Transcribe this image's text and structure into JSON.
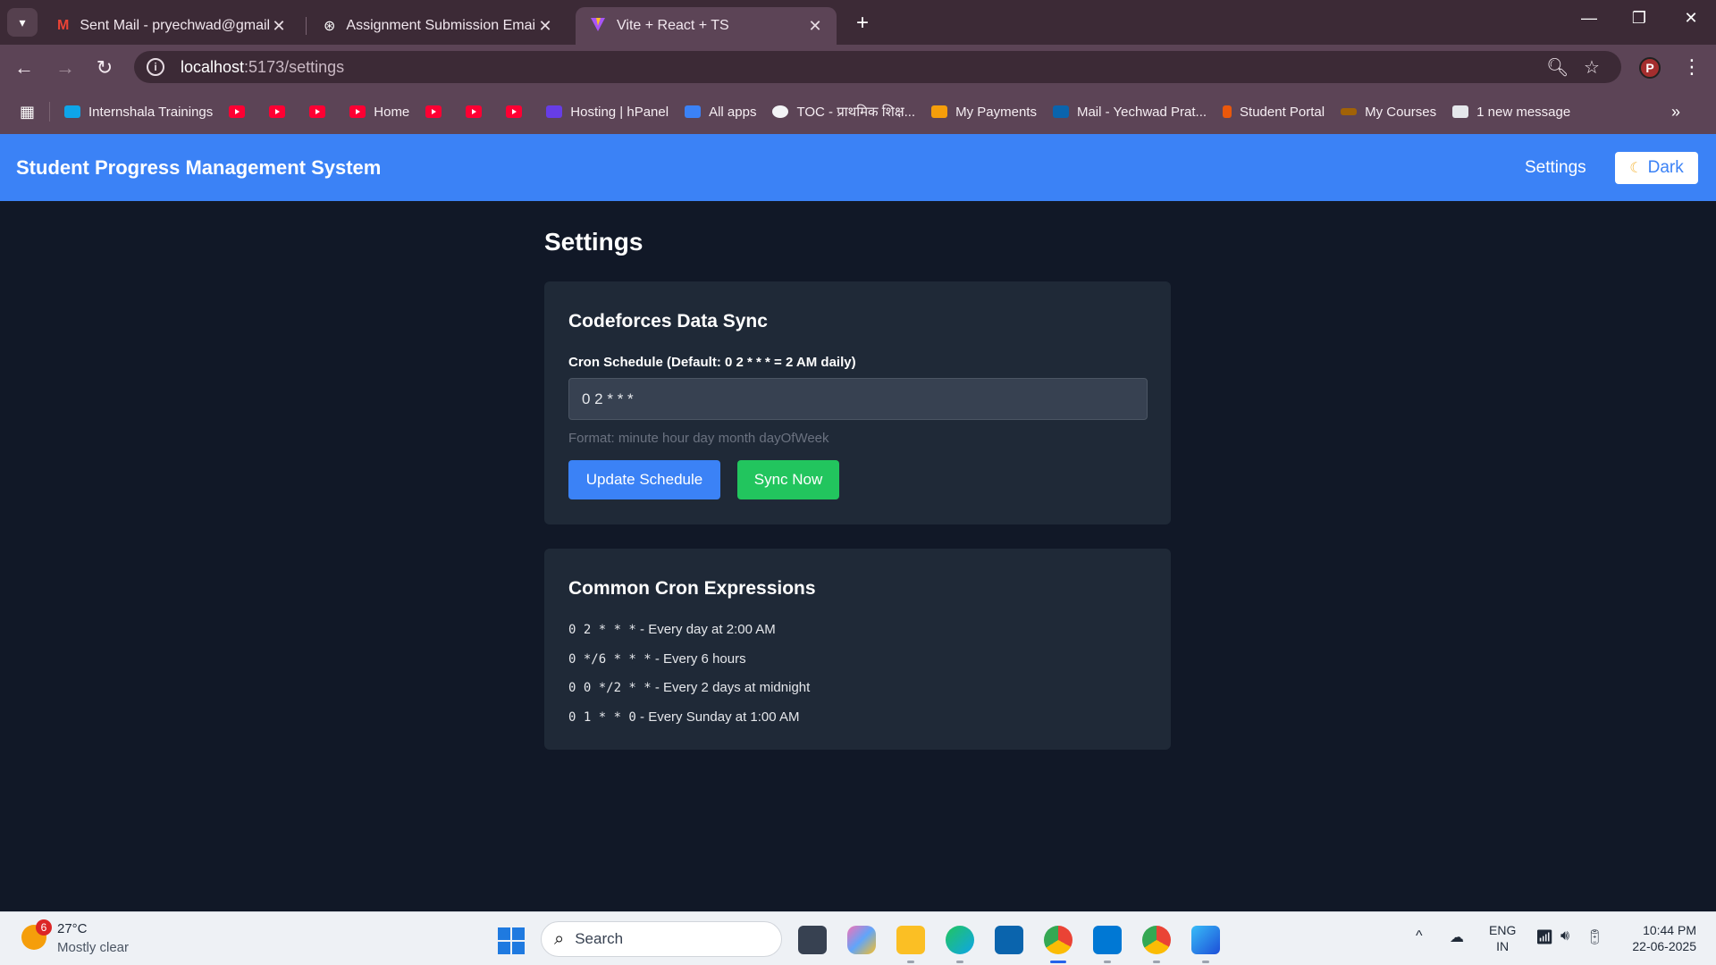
{
  "browser": {
    "tabs": [
      {
        "title": "Sent Mail - pryechwad@gmail.c",
        "icon": "gmail-icon",
        "active": false
      },
      {
        "title": "Assignment Submission Email",
        "icon": "chatgpt-icon",
        "active": false
      },
      {
        "title": "Vite + React + TS",
        "icon": "vite-icon",
        "active": true
      }
    ],
    "url_host": "localhost",
    "url_path": ":5173/settings",
    "profile_initial": "P",
    "bookmarks": [
      {
        "label": "Internshala Trainings",
        "icon": "internshala-icon"
      },
      {
        "label": "",
        "icon": "youtube-icon"
      },
      {
        "label": "",
        "icon": "youtube-icon"
      },
      {
        "label": "",
        "icon": "youtube-icon"
      },
      {
        "label": "Home",
        "icon": "youtube-icon"
      },
      {
        "label": "",
        "icon": "youtube-icon"
      },
      {
        "label": "",
        "icon": "youtube-icon"
      },
      {
        "label": "",
        "icon": "youtube-icon"
      },
      {
        "label": "Hosting | hPanel",
        "icon": "hostinger-icon"
      },
      {
        "label": "All apps",
        "icon": "power-apps-icon"
      },
      {
        "label": "TOC - प्राथमिक शिक्ष...",
        "icon": "toc-icon"
      },
      {
        "label": "My Payments",
        "icon": "payments-icon"
      },
      {
        "label": "Mail - Yechwad Prat...",
        "icon": "outlook-icon"
      },
      {
        "label": "Student Portal",
        "icon": "portal-icon"
      },
      {
        "label": "My Courses",
        "icon": "courses-icon"
      },
      {
        "label": "1 new message",
        "icon": "message-icon"
      }
    ]
  },
  "app": {
    "title": "Student Progress Management System",
    "nav_settings": "Settings",
    "theme_toggle": "Dark",
    "page_title": "Settings",
    "sync_card": {
      "title": "Codeforces Data Sync",
      "label": "Cron Schedule (Default: 0 2 * * * = 2 AM daily)",
      "input_value": "0 2 * * *",
      "hint": "Format: minute hour day month dayOfWeek",
      "update_button": "Update Schedule",
      "sync_button": "Sync Now"
    },
    "expressions_card": {
      "title": "Common Cron Expressions",
      "items": [
        {
          "expr": "0 2 * * *",
          "desc": " - Every day at 2:00 AM"
        },
        {
          "expr": "0 */6 * * *",
          "desc": " - Every 6 hours"
        },
        {
          "expr": "0 0 */2 * *",
          "desc": " - Every 2 days at midnight"
        },
        {
          "expr": "0 1 * * 0",
          "desc": " - Every Sunday at 1:00 AM"
        }
      ]
    }
  },
  "taskbar": {
    "weather_badge": "6",
    "weather_temp": "27°C",
    "weather_desc": "Mostly clear",
    "search_label": "Search",
    "lang_line1": "ENG",
    "lang_line2": "IN",
    "time": "10:44 PM",
    "date": "22-06-2025"
  },
  "colors": {
    "brand": "#3b82f6",
    "sync_green": "#22c55e",
    "page_bg": "#111827",
    "card_bg": "#1f2937",
    "chrome": "#5c4456"
  }
}
